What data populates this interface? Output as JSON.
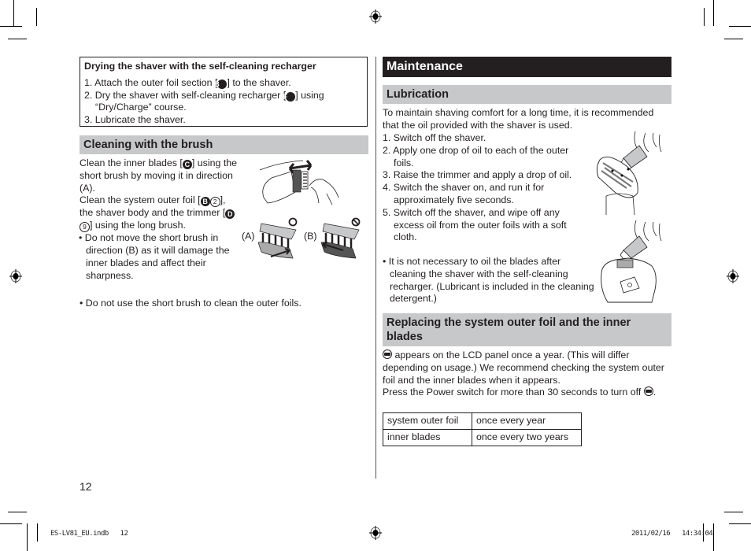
{
  "page_number": "12",
  "slug": {
    "file": "ES-LV81_EU.indb   12",
    "timestamp": "2011/02/16   14:34:04"
  },
  "drying_box": {
    "title": "Drying the shaver with the self-cleaning recharger",
    "step1_a": "1. Attach the outer foil section [",
    "step1_letter": "B",
    "step1_b": "] to the shaver.",
    "step2_a": "2. Dry the shaver with self-cleaning recharger [",
    "step2_letter": "F",
    "step2_b": "] using “Dry/Charge” course.",
    "step3": "3. Lubricate the shaver."
  },
  "brush_section": {
    "heading": "Cleaning with the brush",
    "p1_a": "Clean the inner blades [",
    "p1_letter": "C",
    "p1_b": "] using the short brush by moving it in direction (A).",
    "p2_a": "Clean the system outer foil [",
    "p2_letter1": "B",
    "p2_num1": "2",
    "p2_b": "], the shaver body and the trimmer [",
    "p2_letter2": "D",
    "p2_num2": "9",
    "p2_c": "] using the long brush.",
    "bullet1": "• Do not move the short brush in direction (B) as it will damage the inner blades and affect their sharpness.",
    "bullet2": "• Do not use the short brush to clean the outer foils.",
    "fig_label_a": "(A)",
    "fig_label_b": "(B)"
  },
  "maintenance": {
    "heading": "Maintenance",
    "lubrication": {
      "heading": "Lubrication",
      "intro": "To maintain shaving comfort for a long time, it is recommended that the oil provided with the shaver is used.",
      "steps": [
        "1. Switch off the shaver.",
        "2. Apply one drop of oil to each of the outer foils.",
        "3. Raise the trimmer and apply a drop of oil.",
        "4. Switch the shaver on, and run it for approximately five seconds.",
        "5. Switch off the shaver, and wipe off any excess oil from the outer foils with a soft cloth."
      ],
      "note": "• It is not necessary to oil the blades after cleaning the shaver with the self-cleaning recharger. (Lubricant is included in the cleaning detergent.)"
    },
    "replacing": {
      "heading": "Replacing the system outer foil and the inner blades",
      "p1": " appears on the LCD panel once a year. (This will differ depending on usage.) We recommend checking the system outer foil and the inner blades when it appears.",
      "p2": "Press the Power switch for more than 30 seconds to turn off ",
      "p2_end": ".",
      "table": [
        {
          "part": "system outer foil",
          "interval": "once every year"
        },
        {
          "part": "inner blades",
          "interval": "once every two years"
        }
      ]
    }
  }
}
